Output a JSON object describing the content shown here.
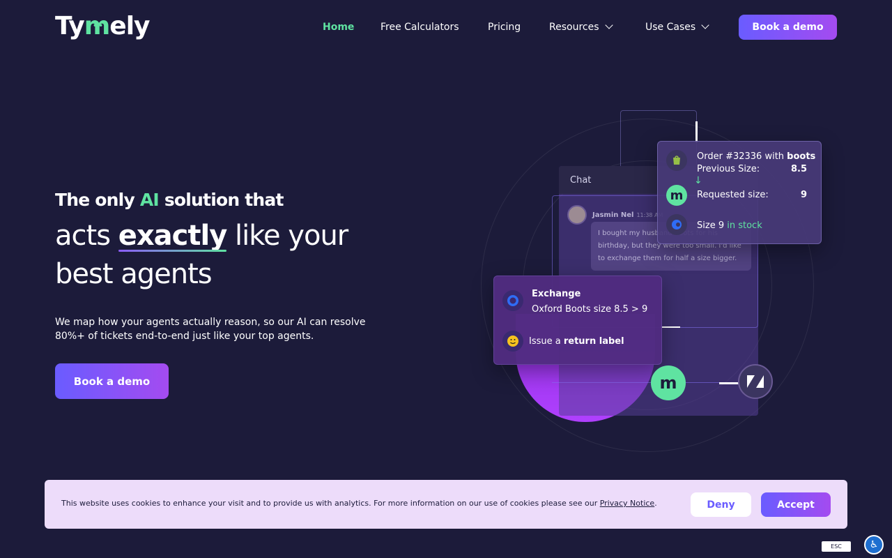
{
  "nav": {
    "logo_prefix": "Ty",
    "logo_m": "m",
    "logo_suffix": "ely",
    "items": [
      {
        "label": "Home"
      },
      {
        "label": "Free Calculators"
      },
      {
        "label": "Pricing"
      },
      {
        "label": "Resources"
      },
      {
        "label": "Use Cases"
      }
    ],
    "cta": "Book a demo"
  },
  "hero": {
    "line1_pre": "The only ",
    "line1_ai": "AI",
    "line1_post": " solution that",
    "line2_pre": "acts ",
    "line2_em": "exactly",
    "line2_post": " like your",
    "line3": "best agents",
    "subtitle": "We map how your agents actually reason, so our AI can resolve 80%+ of tickets end-to-end just like your top agents.",
    "cta": "Book a demo"
  },
  "illustration": {
    "chat_title": "Chat",
    "chat_user": "Jasmin Nel",
    "chat_time": "11:38 AM",
    "chat_message": "I bought my husband boots for his birthday, but they were too small. I'd like to exchange them for half a size bigger.",
    "order_line_pre": "Order #32336 with ",
    "order_line_bold": "boots",
    "prev_size_label": "Previous Size:",
    "prev_size_value": "8.5",
    "req_size_label": "Requested size:",
    "req_size_value": "9",
    "stock_pre": "Size 9 ",
    "stock_status": "in stock",
    "exchange_title": "Exchange",
    "exchange_detail": "Oxford Boots size 8.5 > 9",
    "return_pre": "Issue a ",
    "return_bold": "return label",
    "colors": {
      "accent_green": "#5fe3a1",
      "accent_purple": "#6a5cff",
      "bg": "#1c1b3a"
    }
  },
  "cookie": {
    "text": "This website uses cookies to enhance your visit and to provide us with analytics. For more information on our use of cookies please see our ",
    "link": "Privacy Notice",
    "suffix": ".",
    "deny": "Deny",
    "accept": "Accept"
  },
  "widgets": {
    "esc": "ESC"
  }
}
